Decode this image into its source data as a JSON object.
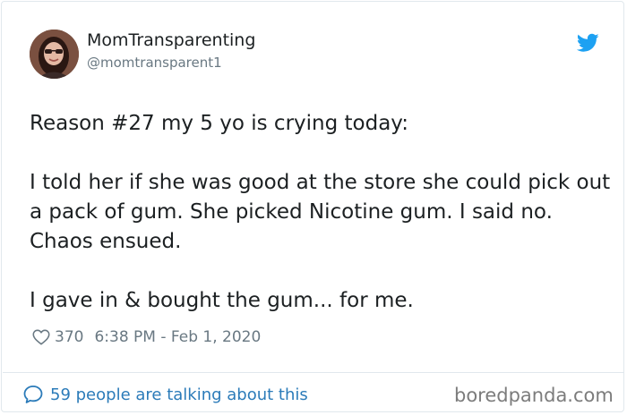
{
  "author": {
    "display_name": "MomTransparenting",
    "handle": "@momtransparent1",
    "avatar_icon": "avatar-photo"
  },
  "tweet": {
    "paragraphs": [
      "Reason #27 my 5 yo is crying today:",
      "I told her if she was good at the store she could pick out a pack of gum. She picked Nicotine gum. I said no. Chaos ensued.",
      "I gave in & bought the gum... for me."
    ],
    "likes": "370",
    "timestamp": "6:38 PM - Feb 1, 2020"
  },
  "footer": {
    "talking_text": "59 people are talking about this",
    "watermark": "boredpanda.com"
  },
  "icons": {
    "platform": "twitter-bird-icon",
    "like": "heart-icon",
    "reply": "speech-bubble-icon"
  },
  "colors": {
    "twitter_blue": "#1da1f2",
    "link_blue": "#2b7bb9",
    "muted": "#697882",
    "text": "#1c2022",
    "border": "#e1e8ed"
  }
}
